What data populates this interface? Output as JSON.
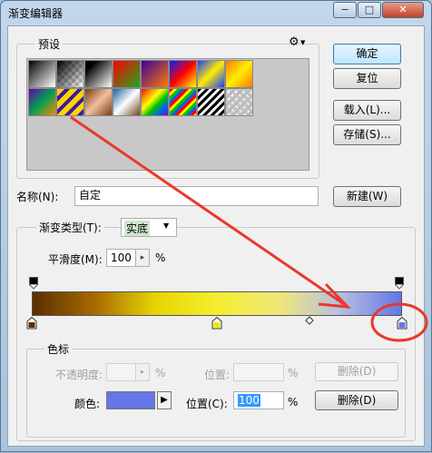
{
  "window": {
    "title": "渐变编辑器",
    "minimize_glyph": "−",
    "maximize_glyph": "□",
    "close_glyph": "✕"
  },
  "presets": {
    "legend": "预设",
    "menu_glyph": "⚙",
    "swatches": [
      {
        "name": "black-white",
        "bg": "linear-gradient(135deg,#000,#fff)"
      },
      {
        "name": "black-transparent",
        "bg": "linear-gradient(135deg,#000,rgba(0,0,0,0))",
        "checker": true
      },
      {
        "name": "black-white-2",
        "bg": "linear-gradient(135deg,#000 20%,#fff)"
      },
      {
        "name": "red-green",
        "bg": "linear-gradient(135deg,#ff0000,#1fa81f)"
      },
      {
        "name": "violet-orange",
        "bg": "linear-gradient(135deg,#3a00a0,#ff7a00)"
      },
      {
        "name": "blue-red-yellow",
        "bg": "linear-gradient(135deg,#0020ff,#ff0000,#ffff00)"
      },
      {
        "name": "blue-yellow-blue",
        "bg": "linear-gradient(135deg,#1a3cff,#ffee00,#1a3cff)"
      },
      {
        "name": "orange-yellow-orange",
        "bg": "linear-gradient(135deg,#ff7a00,#ffee00,#ff7a00)"
      },
      {
        "name": "violet-green-orange",
        "bg": "linear-gradient(135deg,#6a00b0,#00a050,#ff8800)"
      },
      {
        "name": "yellow-violet-stripes",
        "bg": "repeating-linear-gradient(135deg,#ffd200 0 6px,#3a1a9a 6px 10px)"
      },
      {
        "name": "copper",
        "bg": "linear-gradient(135deg,#7a3a10,#f0c0a0,#7a3a10)"
      },
      {
        "name": "chrome",
        "bg": "linear-gradient(135deg,#1a5fa0,#fff 50%,#6a4a20)"
      },
      {
        "name": "spectrum",
        "bg": "linear-gradient(135deg,#ff0000,#ff8800,#ffff00,#00c000,#0060ff,#8000c0)"
      },
      {
        "name": "rainbow-stripes",
        "bg": "repeating-linear-gradient(135deg,#ff0000 0 3px,#ffee00 3px 6px,#00c000 6px 9px,#0060ff 9px 12px)"
      },
      {
        "name": "black-white-stripes",
        "bg": "repeating-linear-gradient(135deg,#000 0 3px,#fff 3px 6px)"
      },
      {
        "name": "transparent-stripes",
        "bg": "repeating-linear-gradient(135deg,#bbb 0 3px,rgba(255,255,255,0) 3px 6px)",
        "checker": true
      }
    ]
  },
  "buttons": {
    "ok": "确定",
    "reset": "复位",
    "load": "载入(L)...",
    "save": "存储(S)...",
    "new": "新建(W)"
  },
  "name_field": {
    "label": "名称(N):",
    "value": "自定"
  },
  "gradient_type": {
    "label": "渐变类型(T):",
    "value": "实底",
    "dropdown_glyph": "▼"
  },
  "smoothness": {
    "label": "平滑度(M):",
    "value": "100",
    "stepper_glyph": "▸",
    "unit": "%"
  },
  "gradient_colors": {
    "bar": [
      "#5a2f00",
      "#a86b00",
      "#e6d400",
      "#f5ee30",
      "#efe67a",
      "#b8c0e0",
      "#6477e6"
    ],
    "stops": [
      {
        "location_percent": 0,
        "color": "#5a2f00"
      },
      {
        "location_percent": 50,
        "color": "#f2e600"
      },
      {
        "location_percent": 100,
        "color": "#6477e6"
      }
    ],
    "midpoint_percent": 75
  },
  "color_stops": {
    "legend": "色标",
    "opacity_label": "不透明度:",
    "opacity_value": "",
    "opacity_unit": "%",
    "opacity_location_label": "位置:",
    "opacity_location_value": "",
    "opacity_location_unit": "%",
    "opacity_delete": "删除(D)",
    "color_label": "颜色:",
    "color_value": "#6477e6",
    "color_menu_glyph": "▶",
    "location_label": "位置(C):",
    "location_value": "100",
    "location_unit": "%",
    "color_delete": "删除(D)"
  },
  "colors": {
    "annotation_red": "#e8392b"
  }
}
